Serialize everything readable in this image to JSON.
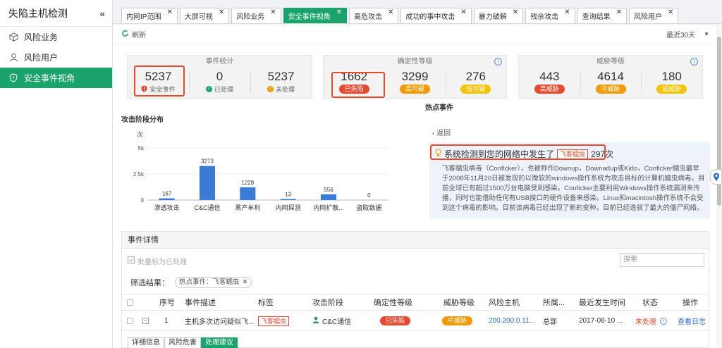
{
  "sidebar": {
    "title": "失陷主机检测",
    "collapse_icon": "«",
    "items": [
      {
        "label": "风险业务",
        "icon": "cube-icon"
      },
      {
        "label": "风险用户",
        "icon": "user-icon"
      },
      {
        "label": "安全事件视角",
        "icon": "shield-icon",
        "active": true
      }
    ]
  },
  "tabs": [
    {
      "label": "内网IP范围"
    },
    {
      "label": "大屏可视"
    },
    {
      "label": "风险业务"
    },
    {
      "label": "安全事件视角",
      "active": true
    },
    {
      "label": "高危攻击"
    },
    {
      "label": "成功的事中攻击"
    },
    {
      "label": "暴力破解"
    },
    {
      "label": "残余攻击"
    },
    {
      "label": "查询结果"
    },
    {
      "label": "风险用户"
    }
  ],
  "tab_close": "✕",
  "toolbar": {
    "refresh_label": "刷新",
    "range_label": "最近30天"
  },
  "stats": {
    "event": {
      "title": "事件统计",
      "cells": [
        {
          "value": "5237",
          "label": "安全事件"
        },
        {
          "value": "0",
          "label": "已处理"
        },
        {
          "value": "5237",
          "label": "未处理"
        }
      ]
    },
    "certainty": {
      "title": "确定性等级",
      "info": "i",
      "cells": [
        {
          "value": "1662",
          "label": "已失陷",
          "color": "#e84a2f"
        },
        {
          "value": "3299",
          "label": "高可疑",
          "color": "#f29a00"
        },
        {
          "value": "276",
          "label": "低可疑",
          "color": "#f5c400"
        }
      ]
    },
    "threat": {
      "title": "威胁等级",
      "info": "i",
      "cells": [
        {
          "value": "443",
          "label": "高威胁",
          "color": "#e84a2f"
        },
        {
          "value": "4614",
          "label": "中威胁",
          "color": "#f29a00"
        },
        {
          "value": "180",
          "label": "低威胁",
          "color": "#f5c400"
        }
      ]
    }
  },
  "chart_title": "攻击阶段分布",
  "chart_data": {
    "type": "bar",
    "title": "攻击阶段分布",
    "ylabel": "次",
    "ylim": [
      0,
      5000
    ],
    "yticks": [
      "0",
      "2.5k",
      "5k"
    ],
    "categories": [
      "渗透攻击",
      "C&C通信",
      "黑产牟利",
      "内网探测",
      "内网扩散...",
      "盗取数据"
    ],
    "values": [
      167,
      3273,
      1228,
      13,
      556,
      0
    ],
    "color": "#3a7bd5"
  },
  "hot": {
    "title": "热点事件",
    "back_label": "返回",
    "headline_prefix": "系统检测到您的网络中发生了",
    "headline_tag": "飞客蠕虫",
    "headline_count": "297次",
    "description": "飞客蠕虫病毒（Conficker），也被称作Downup，Downadup或Kido，Conficker蠕虫最早于2008年11月20日被发现的以微软的windows操作系统为攻击目标的计算机蠕虫病毒。目前全球已有超过1500万台电脑受到感染。Conficker主要利用Windows操作系统漏洞来传播，同时也能借助任何有USB接口的硬件设备来感染。Linux和macintosh操作系统不会受到这个病毒的影响。目前该病毒已经出现了新的变种，目前已经造就了最大的僵尸网络。"
  },
  "detail": {
    "title": "事件详情",
    "mark_label": "批量标为已处理",
    "search_placeholder": "搜索",
    "filter_label": "筛选结果：",
    "filter_chip": "热点事件：飞客蠕虫",
    "columns": [
      "序号",
      "事件描述",
      "标签",
      "攻击阶段",
      "确定性等级",
      "威胁等级",
      "风险主机",
      "所属...",
      "最近发生时间",
      "状态",
      "操作"
    ],
    "rows": [
      {
        "index": "1",
        "desc": "主机多次访问疑似飞...",
        "tag": "飞客蠕虫",
        "stage": "C&C通信",
        "certainty": "已失陷",
        "threat": "中威胁",
        "host": "200.200.0.11...",
        "group": "总部",
        "time": "2017-08-10 ...",
        "status": "未处理",
        "action": "查看日志"
      }
    ],
    "subtabs": [
      "详细信息",
      "风险危害",
      "处理建议"
    ]
  }
}
